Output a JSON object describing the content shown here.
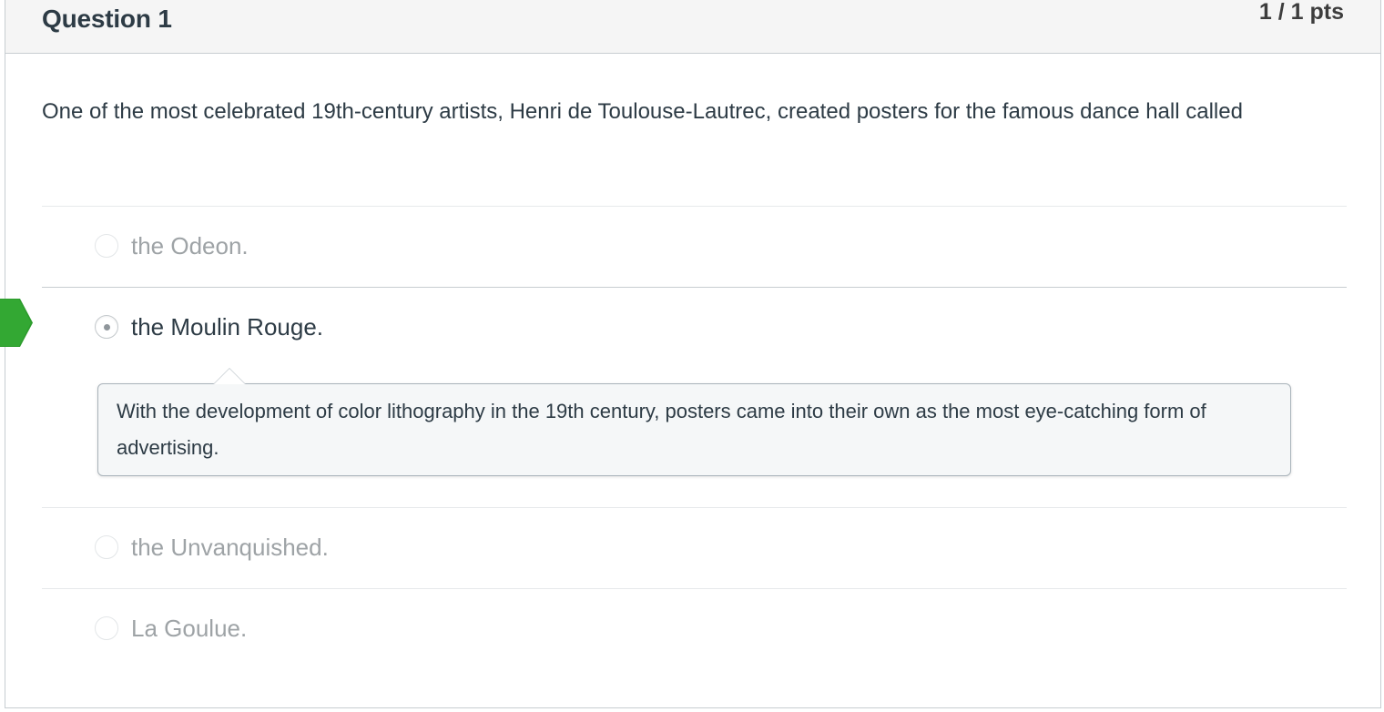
{
  "question": {
    "title": "Question 1",
    "points": "1 / 1 pts",
    "text": "One of the most celebrated 19th-century artists, Henri de Toulouse-Lautrec, created posters for the famous dance hall called"
  },
  "answers": [
    {
      "label": "the Odeon.",
      "selected": false
    },
    {
      "label": "the Moulin Rouge.",
      "selected": true
    },
    {
      "label": "the Unvanquished.",
      "selected": false
    },
    {
      "label": "La Goulue.",
      "selected": false
    }
  ],
  "comment": {
    "text": "With the development of color lithography in the 19th century, posters came into their own as the most eye-catching form of advertising."
  },
  "colors": {
    "correct_marker": "#2c9b2c",
    "header_bg": "#f5f5f5",
    "comment_bg": "#f5f7f8"
  },
  "icons": {
    "correct_marker": "correct-answer-arrow-icon"
  }
}
